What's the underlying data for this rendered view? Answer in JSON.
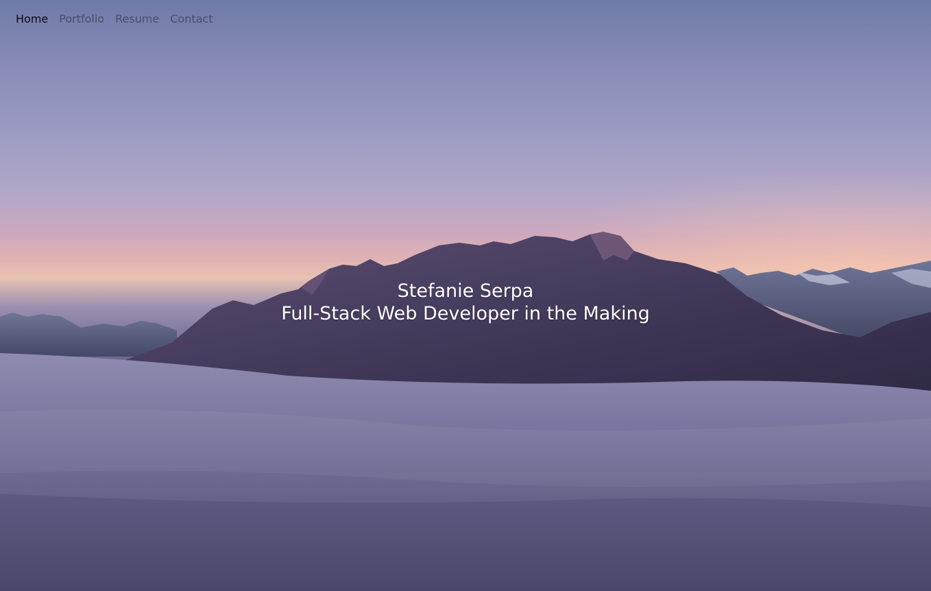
{
  "nav": {
    "items": [
      {
        "label": "Home",
        "active": true
      },
      {
        "label": "Portfolio",
        "active": false
      },
      {
        "label": "Resume",
        "active": false
      },
      {
        "label": "Contact",
        "active": false
      }
    ]
  },
  "hero": {
    "name": "Stefanie Serpa",
    "tagline": "Full-Stack Web Developer in the Making"
  },
  "colors": {
    "nav_active": "#0b0b1a",
    "nav_inactive": "#4c4d6a",
    "headline": "#ffffff"
  }
}
